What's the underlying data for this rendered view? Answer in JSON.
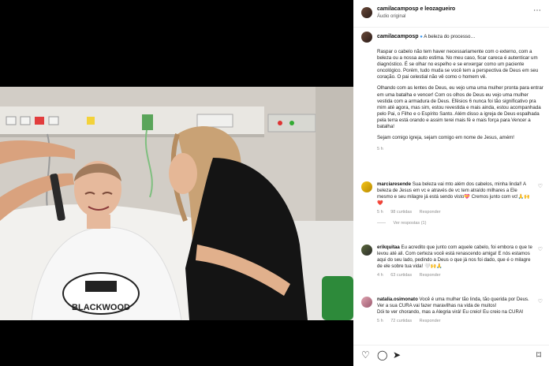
{
  "header": {
    "usernames": "camilacamposp e leozagueiro",
    "audio": "Áudio original"
  },
  "caption": {
    "username": "camilacamposp",
    "title": "A beleza do processo…",
    "p1": "Raspar o cabelo não tem haver necessariamente com o externo, com a beleza ou a nossa auto estima. No meu caso, ficar careca é autenticar um diagnóstico. É se olhar no espelho e se enxergar como um paciente oncológico. Porém, tudo muda se você tem a perspectiva de Deus em seu coração. O pai celestial não vê como o homem vê.",
    "p2": "Olhando com as lentes de Deus, eu vejo uma uma mulher pronta para entrar em uma batalha e vencer! Com os olhos de Deus eu vejo uma mulher vestida com a armadura de Deus. Efésios 6 nunca foi tão significativo pra mim até agora, mas sim, estou revestida e mais ainda, estou acompanhada pelo Pai, o Filho e o Espírito Santo. Além disso a igreja de Deus espalhada pela terra está orando e assim terei mais fé e mais força para Vencer a batalha!",
    "p3": "Sejam comigo igreja, sejam comigo em nome de Jesus, amém!",
    "time": "5 h"
  },
  "comments": [
    {
      "username": "marciaresende",
      "text": "Sua beleza vai mto além dos cabelos, minha linda!! A beleza de Jesus em vc e através de vc tem atraído milhares a Ele mesmo e seu milagre já está sendo visto💝 Cremos junto com vc!🙏🙌❤️",
      "time": "5 h",
      "likes": "98 curtidas",
      "reply": "Responder",
      "view_replies": "Ver respostas (1)"
    },
    {
      "username": "erikquitaa",
      "text": "Eu acredito que junto com aquele cabelo, foi embora o que te levou até ali. Com certeza você está renascendo amiga! E nós estamos aqui do seu lado, pedindo a Deus o que já nos foi dado, que é o milagre de ele sobre tua vida! 🤍🙌🙏",
      "time": "4 h",
      "likes": "63 curtidas",
      "reply": "Responder"
    },
    {
      "username": "natalia.osimonato",
      "text": "Você é uma mulher tão linda, tão querida por Deus. Ver a sua CURA vai fazer maravilhas na vida de muitos!\nDói te ver chorando, mas a Alegria virá! Eu creio! Eu creio na CURA!",
      "time": "5 h",
      "likes": "72 curtidas",
      "reply": "Responder"
    }
  ],
  "media": {
    "cape_text": "BLACKWOOD"
  },
  "colors": {
    "link": "#00376b",
    "meta": "#8e8e8e",
    "verified": "#3897f0"
  },
  "icons": [
    "heart-icon",
    "comment-icon",
    "share-icon",
    "bookmark-icon",
    "verified-icon",
    "more-icon"
  ]
}
